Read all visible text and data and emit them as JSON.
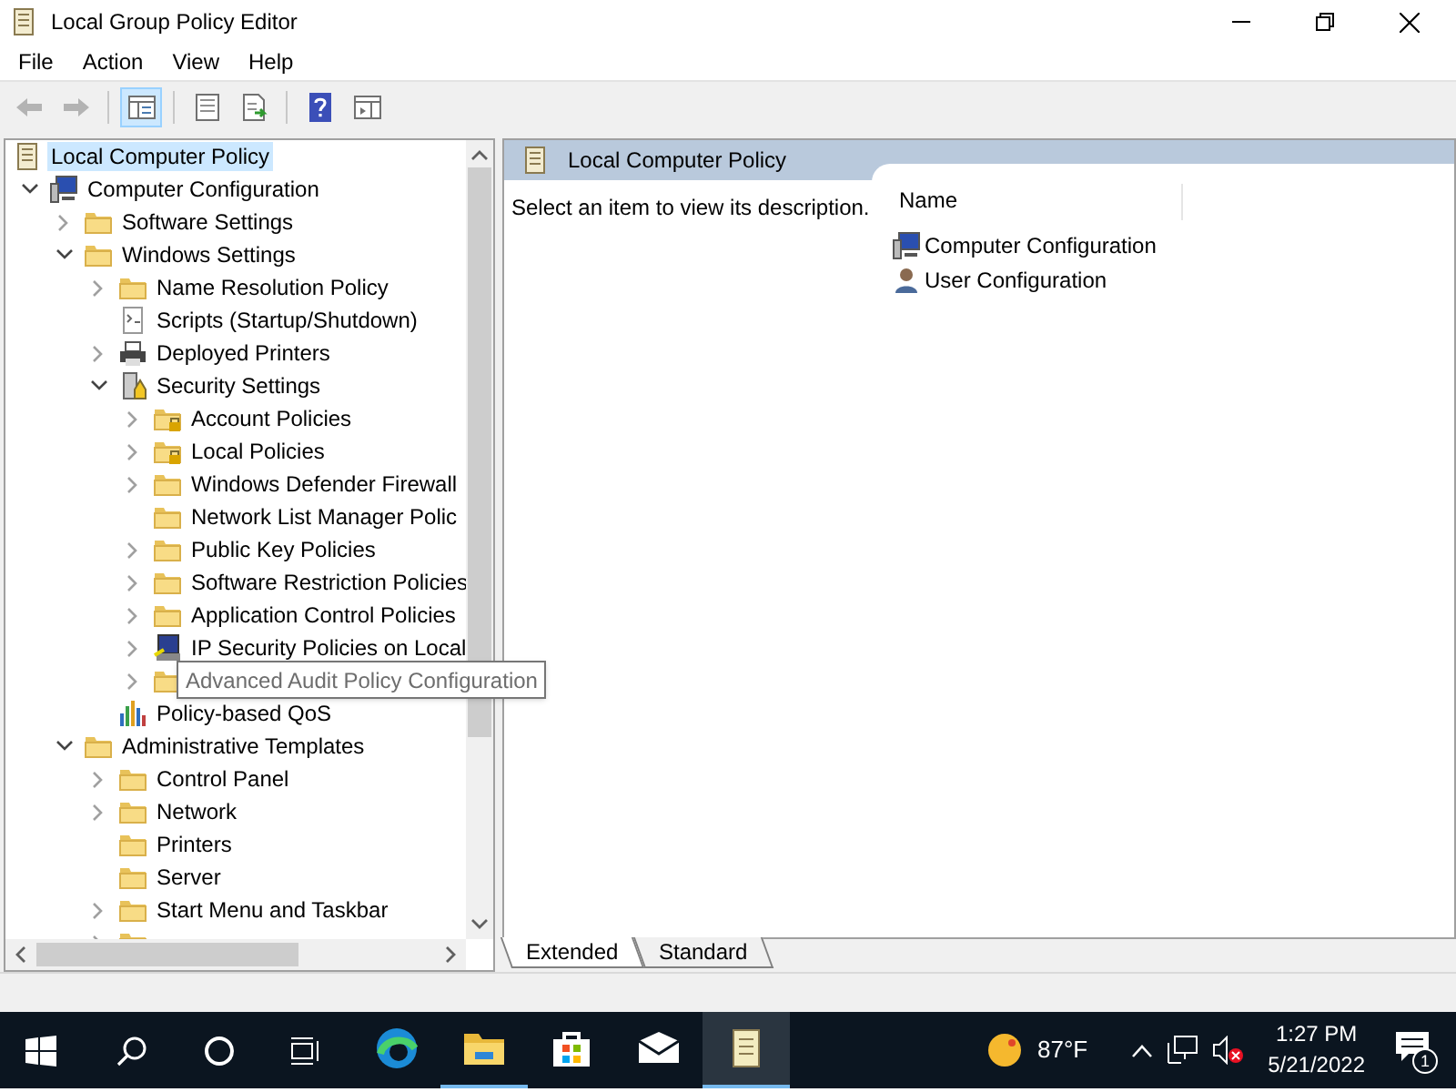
{
  "window": {
    "title": "Local Group Policy Editor"
  },
  "menu": [
    "File",
    "Action",
    "View",
    "Help"
  ],
  "toolbar": [
    {
      "kind": "back",
      "disabled": true,
      "pressed": false
    },
    {
      "kind": "forward",
      "disabled": true,
      "pressed": false
    },
    {
      "kind": "sep"
    },
    {
      "kind": "tree",
      "disabled": false,
      "pressed": true
    },
    {
      "kind": "sep"
    },
    {
      "kind": "properties",
      "disabled": false,
      "pressed": false
    },
    {
      "kind": "export",
      "disabled": false,
      "pressed": false
    },
    {
      "kind": "sep"
    },
    {
      "kind": "help",
      "disabled": false,
      "pressed": false
    },
    {
      "kind": "panel",
      "disabled": false,
      "pressed": false
    }
  ],
  "tree": [
    {
      "label": "Local Computer Policy",
      "kind": "policy",
      "selected": true,
      "children": [
        {
          "label": "Computer Configuration",
          "kind": "computer",
          "expanded": true,
          "selected": false,
          "children": [
            {
              "label": "Software Settings",
              "kind": "folder",
              "expanded": false,
              "selected": false
            },
            {
              "label": "Windows Settings",
              "kind": "folder",
              "expanded": true,
              "selected": false,
              "children": [
                {
                  "label": "Name Resolution Policy",
                  "kind": "folder",
                  "expanded": false,
                  "selected": false
                },
                {
                  "label": "Scripts (Startup/Shutdown)",
                  "kind": "scripts",
                  "selected": false
                },
                {
                  "label": "Deployed Printers",
                  "kind": "printer",
                  "expanded": false,
                  "selected": false
                },
                {
                  "label": "Security Settings",
                  "kind": "security",
                  "expanded": true,
                  "selected": false,
                  "children": [
                    {
                      "label": "Account Policies",
                      "kind": "lockfolder",
                      "expanded": false,
                      "selected": false
                    },
                    {
                      "label": "Local Policies",
                      "kind": "lockfolder",
                      "expanded": false,
                      "selected": false
                    },
                    {
                      "label": "Windows Defender Firewall",
                      "kind": "folder",
                      "expanded": false,
                      "selected": false
                    },
                    {
                      "label": "Network List Manager Polic",
                      "kind": "folder",
                      "selected": false
                    },
                    {
                      "label": "Public Key Policies",
                      "kind": "folder",
                      "expanded": false,
                      "selected": false
                    },
                    {
                      "label": "Software Restriction Policies",
                      "kind": "folder",
                      "expanded": false,
                      "selected": false
                    },
                    {
                      "label": "Application Control Policies",
                      "kind": "folder",
                      "expanded": false,
                      "selected": false
                    },
                    {
                      "label": "IP Security Policies on Local",
                      "kind": "ipsec",
                      "expanded": false,
                      "selected": false
                    },
                    {
                      "kind": "folder",
                      "expanded": false,
                      "selected": false
                    }
                  ]
                },
                {
                  "label": "Policy-based QoS",
                  "kind": "qos",
                  "selected": false
                }
              ]
            },
            {
              "label": "Administrative Templates",
              "kind": "folder",
              "expanded": true,
              "selected": false,
              "children": [
                {
                  "label": "Control Panel",
                  "kind": "folder",
                  "expanded": false,
                  "selected": false
                },
                {
                  "label": "Network",
                  "kind": "folder",
                  "expanded": false,
                  "selected": false
                },
                {
                  "label": "Printers",
                  "kind": "folder",
                  "selected": false
                },
                {
                  "label": "Server",
                  "kind": "folder",
                  "selected": false
                },
                {
                  "label": "Start Menu and Taskbar",
                  "kind": "folder",
                  "expanded": false,
                  "selected": false
                },
                {
                  "kind": "folder",
                  "expanded": false,
                  "selected": false
                }
              ]
            }
          ]
        }
      ]
    }
  ],
  "tooltip": "Advanced Audit Policy Configuration",
  "details": {
    "title": "Local Computer Policy",
    "description": "Select an item to view its description.",
    "column": "Name",
    "items": [
      {
        "label": "Computer Configuration",
        "kind": "computer"
      },
      {
        "label": "User Configuration",
        "kind": "user"
      }
    ]
  },
  "tabs": [
    {
      "label": "Extended",
      "selected": true
    },
    {
      "label": "Standard",
      "selected": false
    }
  ],
  "taskbar": {
    "apps": [
      {
        "kind": "edge",
        "running": false,
        "active": false
      },
      {
        "kind": "explorer",
        "running": true,
        "active": false
      },
      {
        "kind": "store",
        "running": false,
        "active": false
      },
      {
        "kind": "mail",
        "running": false,
        "active": false
      },
      {
        "kind": "gpedit",
        "running": true,
        "active": true
      }
    ],
    "temperature": "87°F",
    "time": "1:27 PM",
    "date": "5/21/2022",
    "notifications": "1"
  }
}
